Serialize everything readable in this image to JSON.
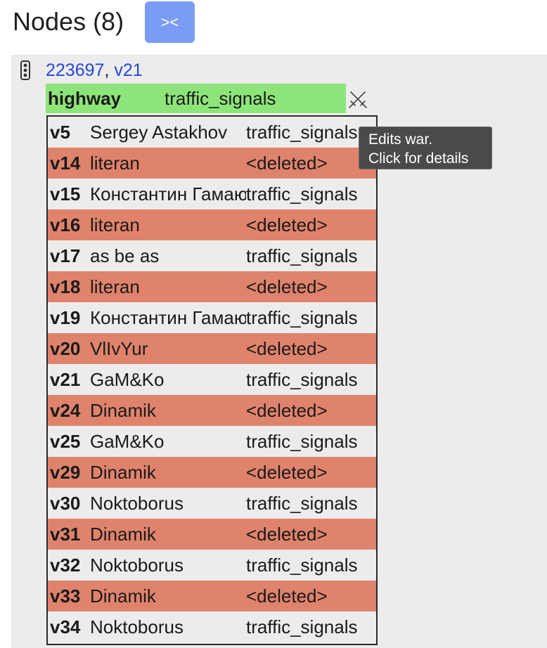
{
  "header": {
    "title": "Nodes (8)",
    "collapse_label": "><"
  },
  "node": {
    "id": "223697",
    "separator": ",",
    "version": "v21",
    "icon": "traffic-light-icon"
  },
  "tag": {
    "key": "highway",
    "value": "traffic_signals",
    "war_icon": "crossed-swords-icon"
  },
  "tooltip": {
    "line1": "Edits war.",
    "line2": "Click for details"
  },
  "history": [
    {
      "version": "v5",
      "user": "Sergey Astakhov",
      "value": "traffic_signals",
      "deleted": false
    },
    {
      "version": "v14",
      "user": "literan",
      "value": "<deleted>",
      "deleted": true
    },
    {
      "version": "v15",
      "user": "Константин Гамаюнов",
      "value": "traffic_signals",
      "deleted": false
    },
    {
      "version": "v16",
      "user": "literan",
      "value": "<deleted>",
      "deleted": true
    },
    {
      "version": "v17",
      "user": "as be as",
      "value": "traffic_signals",
      "deleted": false
    },
    {
      "version": "v18",
      "user": "literan",
      "value": "<deleted>",
      "deleted": true
    },
    {
      "version": "v19",
      "user": "Константин Гамаюнов",
      "value": "traffic_signals",
      "deleted": false
    },
    {
      "version": "v20",
      "user": "VlIvYur",
      "value": "<deleted>",
      "deleted": true
    },
    {
      "version": "v21",
      "user": "GaM&Ko",
      "value": "traffic_signals",
      "deleted": false
    },
    {
      "version": "v24",
      "user": "Dinamik",
      "value": "<deleted>",
      "deleted": true
    },
    {
      "version": "v25",
      "user": "GaM&Ko",
      "value": "traffic_signals",
      "deleted": false
    },
    {
      "version": "v29",
      "user": "Dinamik",
      "value": "<deleted>",
      "deleted": true
    },
    {
      "version": "v30",
      "user": "Noktoborus",
      "value": "traffic_signals",
      "deleted": false
    },
    {
      "version": "v31",
      "user": "Dinamik",
      "value": "<deleted>",
      "deleted": true
    },
    {
      "version": "v32",
      "user": "Noktoborus",
      "value": "traffic_signals",
      "deleted": false
    },
    {
      "version": "v33",
      "user": "Dinamik",
      "value": "<deleted>",
      "deleted": true
    },
    {
      "version": "v34",
      "user": "Noktoborus",
      "value": "traffic_signals",
      "deleted": false
    }
  ],
  "colors": {
    "deleted_row": "#e0836c",
    "tag_row": "#8de57a",
    "button": "#7b9cf5",
    "link": "#2747d6"
  }
}
